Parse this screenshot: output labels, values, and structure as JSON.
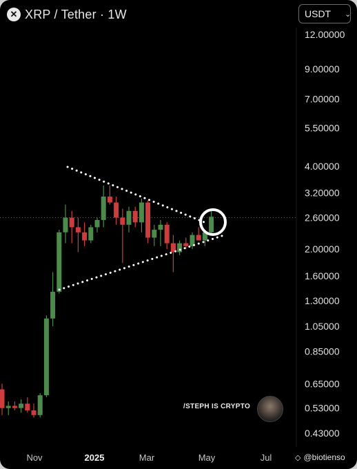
{
  "header": {
    "logo_icon": "x-logo-icon",
    "title": "XRP / Tether · 1W",
    "currency": "USDT"
  },
  "watermark": "/STEPH IS CRYPTO",
  "source": "@biotienso",
  "chart_data": {
    "type": "candlestick",
    "scale": "log",
    "y_ticks": [
      "12.00000",
      "9.00000",
      "7.00000",
      "5.50000",
      "4.00000",
      "3.20000",
      "2.60000",
      "2.00000",
      "1.60000",
      "1.30000",
      "1.05000",
      "0.85000",
      "0.65000",
      "0.53000",
      "0.43000"
    ],
    "x_ticks": [
      "Nov",
      "2025",
      "Mar",
      "May",
      "Jul"
    ],
    "current_price_line": 2.6,
    "colors": {
      "up": "#4c8c4a",
      "down": "#d23b3b",
      "grid": "#1a1a1a",
      "axis_text": "#e0e0e0",
      "trendline": "#ffffff",
      "highlight": "#ffffff"
    },
    "candles": [
      {
        "o": 0.62,
        "h": 0.65,
        "l": 0.5,
        "c": 0.53
      },
      {
        "o": 0.53,
        "h": 0.56,
        "l": 0.5,
        "c": 0.54
      },
      {
        "o": 0.54,
        "h": 0.56,
        "l": 0.52,
        "c": 0.53
      },
      {
        "o": 0.53,
        "h": 0.57,
        "l": 0.51,
        "c": 0.55
      },
      {
        "o": 0.55,
        "h": 0.58,
        "l": 0.51,
        "c": 0.52
      },
      {
        "o": 0.52,
        "h": 0.55,
        "l": 0.49,
        "c": 0.5
      },
      {
        "o": 0.5,
        "h": 0.6,
        "l": 0.49,
        "c": 0.59
      },
      {
        "o": 0.59,
        "h": 1.15,
        "l": 0.58,
        "c": 1.12
      },
      {
        "o": 1.12,
        "h": 1.65,
        "l": 1.05,
        "c": 1.4
      },
      {
        "o": 1.4,
        "h": 2.35,
        "l": 1.38,
        "c": 2.3
      },
      {
        "o": 2.3,
        "h": 2.9,
        "l": 2.1,
        "c": 2.6
      },
      {
        "o": 2.6,
        "h": 2.75,
        "l": 2.1,
        "c": 2.4
      },
      {
        "o": 2.4,
        "h": 2.6,
        "l": 1.95,
        "c": 2.3
      },
      {
        "o": 2.3,
        "h": 2.5,
        "l": 2.05,
        "c": 2.15
      },
      {
        "o": 2.15,
        "h": 2.45,
        "l": 2.1,
        "c": 2.4
      },
      {
        "o": 2.4,
        "h": 2.6,
        "l": 2.3,
        "c": 2.55
      },
      {
        "o": 2.55,
        "h": 3.4,
        "l": 2.4,
        "c": 3.1
      },
      {
        "o": 3.1,
        "h": 3.4,
        "l": 2.9,
        "c": 2.95
      },
      {
        "o": 2.95,
        "h": 3.1,
        "l": 2.45,
        "c": 2.6
      },
      {
        "o": 2.6,
        "h": 2.8,
        "l": 1.78,
        "c": 2.45
      },
      {
        "o": 2.45,
        "h": 2.85,
        "l": 2.3,
        "c": 2.75
      },
      {
        "o": 2.75,
        "h": 2.85,
        "l": 2.4,
        "c": 2.5
      },
      {
        "o": 2.5,
        "h": 3.05,
        "l": 2.3,
        "c": 2.95
      },
      {
        "o": 2.95,
        "h": 3.0,
        "l": 2.1,
        "c": 2.2
      },
      {
        "o": 2.2,
        "h": 2.45,
        "l": 2.05,
        "c": 2.35
      },
      {
        "o": 2.35,
        "h": 2.55,
        "l": 2.05,
        "c": 2.45
      },
      {
        "o": 2.45,
        "h": 2.5,
        "l": 2.0,
        "c": 2.1
      },
      {
        "o": 2.1,
        "h": 2.25,
        "l": 1.65,
        "c": 1.95
      },
      {
        "o": 1.95,
        "h": 2.15,
        "l": 1.9,
        "c": 2.1
      },
      {
        "o": 2.1,
        "h": 2.2,
        "l": 2.0,
        "c": 2.05
      },
      {
        "o": 2.05,
        "h": 2.3,
        "l": 2.0,
        "c": 2.25
      },
      {
        "o": 2.25,
        "h": 2.4,
        "l": 2.15,
        "c": 2.15
      },
      {
        "o": 2.15,
        "h": 2.35,
        "l": 2.05,
        "c": 2.3
      },
      {
        "o": 2.3,
        "h": 2.75,
        "l": 2.25,
        "c": 2.62
      }
    ]
  }
}
